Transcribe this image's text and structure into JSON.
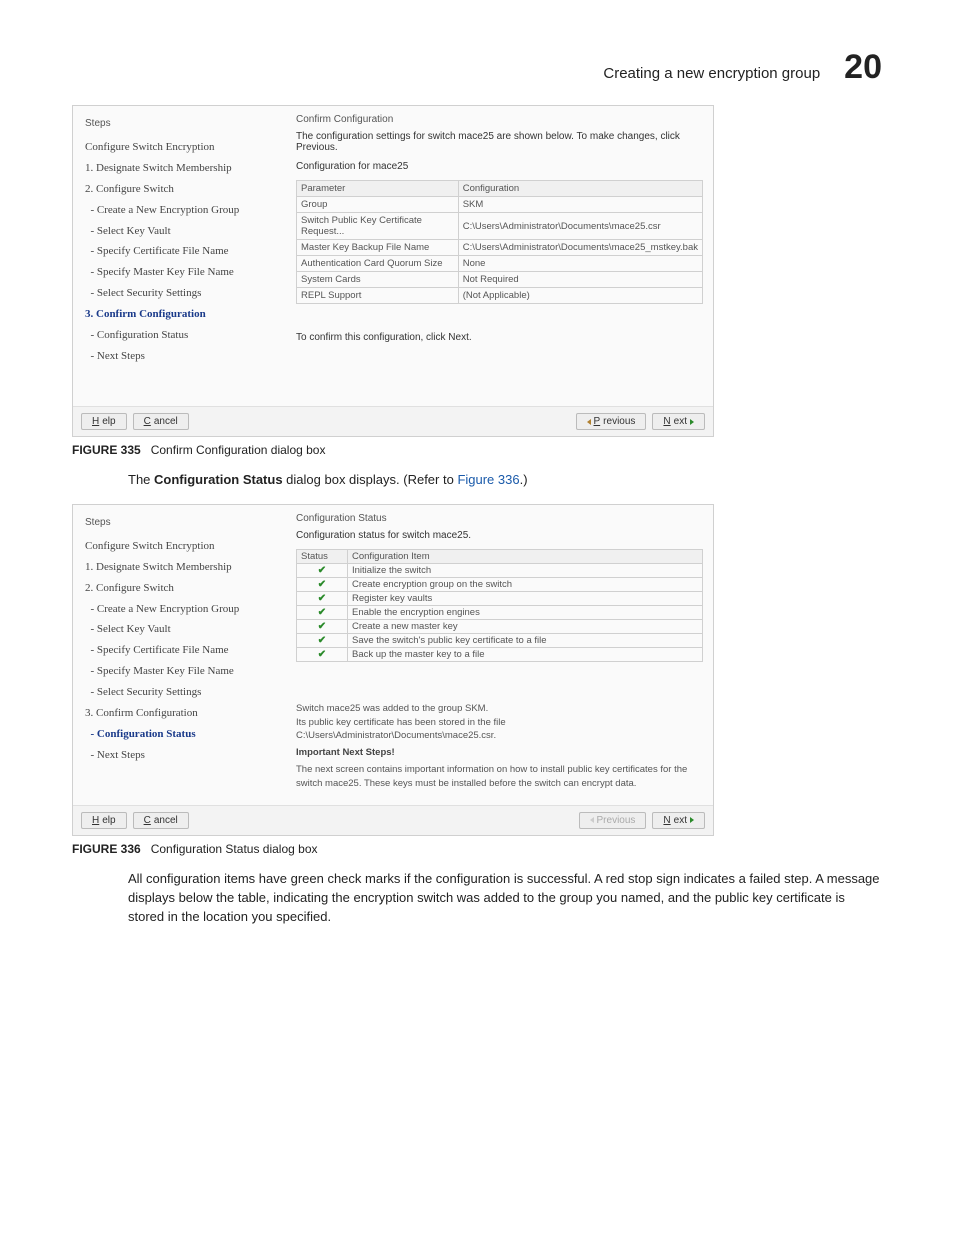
{
  "header": {
    "title": "Creating a new encryption group",
    "number": "20"
  },
  "figure335": {
    "caption_label": "FIGURE 335",
    "caption_text": "Confirm Configuration dialog box",
    "steps_label": "Steps",
    "steps": [
      "Configure Switch Encryption",
      "1. Designate Switch Membership",
      "2. Configure Switch",
      "  - Create a New Encryption Group",
      "  - Select Key Vault",
      "  - Specify Certificate File Name",
      "  - Specify Master Key File Name",
      "  - Select Security Settings",
      "3. Confirm Configuration",
      "  - Configuration Status",
      "  - Next Steps"
    ],
    "current_step_index": 8,
    "right_label": "Confirm Configuration",
    "intro": "The configuration settings for switch mace25 are shown below. To make changes, click Previous.",
    "subhead": "Configuration for mace25",
    "table": {
      "headers": [
        "Parameter",
        "Configuration"
      ],
      "rows": [
        [
          "Group",
          "SKM"
        ],
        [
          "Switch Public Key Certificate Request...",
          "C:\\Users\\Administrator\\Documents\\mace25.csr"
        ],
        [
          "Master Key Backup File Name",
          "C:\\Users\\Administrator\\Documents\\mace25_mstkey.bak"
        ],
        [
          "Authentication Card Quorum Size",
          "None"
        ],
        [
          "System Cards",
          "Not Required"
        ],
        [
          "REPL Support",
          "(Not Applicable)"
        ]
      ]
    },
    "confirm_line": "To confirm this configuration, click Next.",
    "buttons": {
      "help": "Help",
      "cancel": "Cancel",
      "previous": "Previous",
      "next": "Next"
    }
  },
  "mid_text": {
    "pre": "The ",
    "bold": "Configuration Status",
    "post": " dialog box displays. (Refer to ",
    "link": "Figure 336",
    "tail": ".)"
  },
  "figure336": {
    "caption_label": "FIGURE 336",
    "caption_text": "Configuration Status dialog box",
    "steps_label": "Steps",
    "steps": [
      "Configure Switch Encryption",
      "1. Designate Switch Membership",
      "2. Configure Switch",
      "  - Create a New Encryption Group",
      "  - Select Key Vault",
      "  - Specify Certificate File Name",
      "  - Specify Master Key File Name",
      "  - Select Security Settings",
      "3. Confirm Configuration",
      "  - Configuration Status",
      "  - Next Steps"
    ],
    "current_step_index": 9,
    "right_label": "Configuration Status",
    "intro": "Configuration status for switch mace25.",
    "table": {
      "headers": [
        "Status",
        "Configuration Item"
      ],
      "rows": [
        [
          "check",
          "Initialize the switch"
        ],
        [
          "check",
          "Create encryption group on the switch"
        ],
        [
          "check",
          "Register key vaults"
        ],
        [
          "check",
          "Enable the encryption engines"
        ],
        [
          "check",
          "Create a new master key"
        ],
        [
          "check",
          "Save the switch's public key certificate to a file"
        ],
        [
          "check",
          "Back up the master key to a file"
        ]
      ]
    },
    "msg1": "Switch mace25 was added to the group SKM.",
    "msg2": "Its public key certificate has been stored in the file C:\\Users\\Administrator\\Documents\\mace25.csr.",
    "important_label": "Important Next Steps!",
    "msg3": "The next screen contains important information on how to install public key certificates for the switch mace25. These keys must be installed before the switch can encrypt data.",
    "buttons": {
      "help": "Help",
      "cancel": "Cancel",
      "previous": "Previous",
      "next": "Next"
    }
  },
  "trailing_text": "All configuration items have green check marks if the configuration is successful. A red stop sign indicates a failed step. A message displays below the table, indicating the encryption switch was added to the group you named, and the public key certificate is stored in the location you specified."
}
